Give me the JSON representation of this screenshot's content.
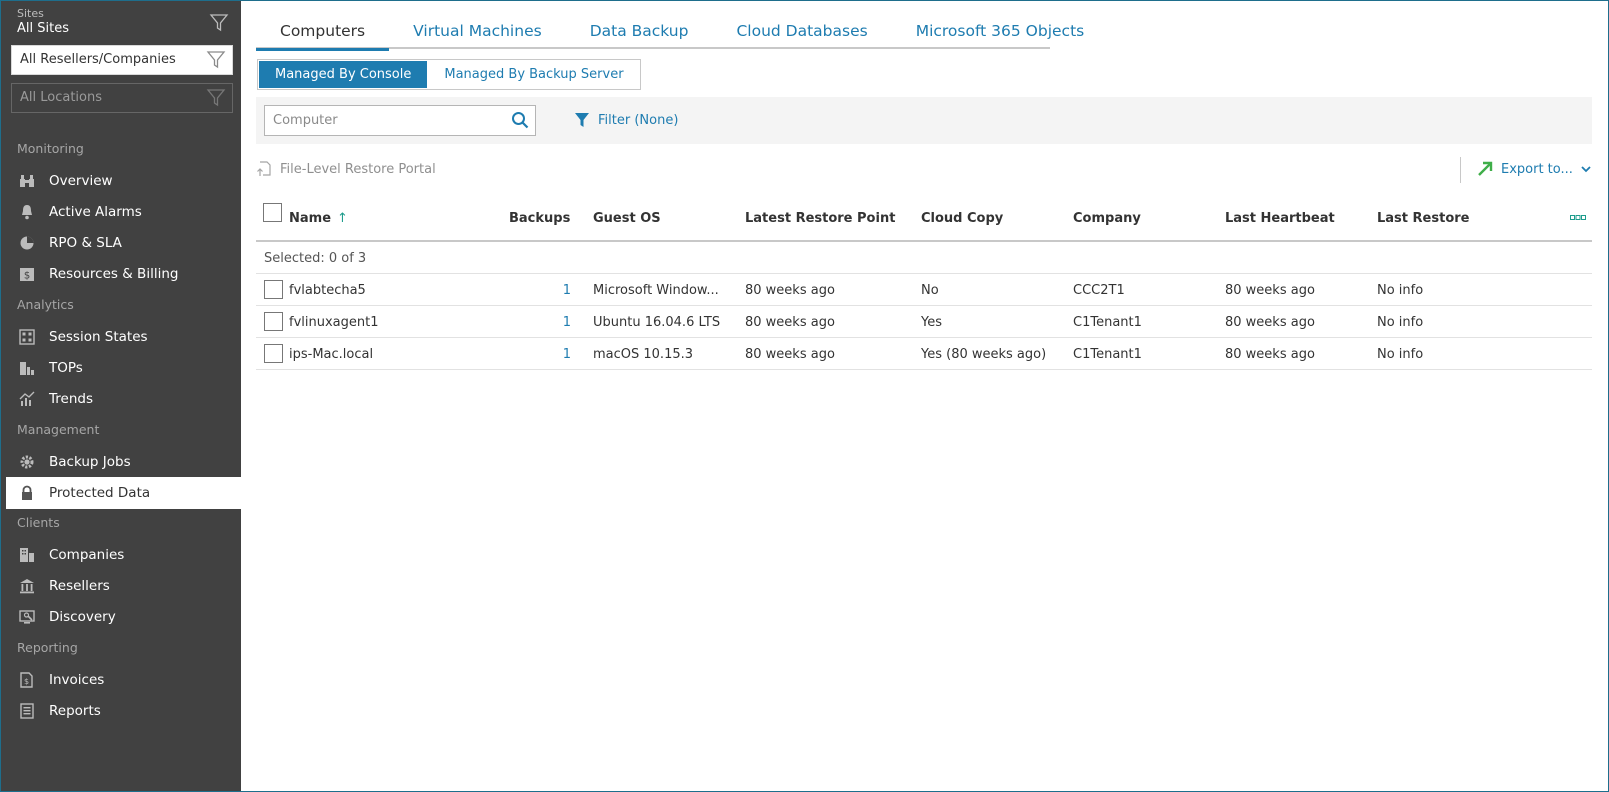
{
  "sidebar": {
    "site_label": "Sites",
    "site_value": "All Sites",
    "reseller_filter": "All Resellers/Companies",
    "location_filter": "All Locations",
    "sections": {
      "monitoring": "Monitoring",
      "analytics": "Analytics",
      "management": "Management",
      "clients": "Clients",
      "reporting": "Reporting"
    },
    "items": {
      "overview": "Overview",
      "active_alarms": "Active Alarms",
      "rpo_sla": "RPO & SLA",
      "resources_billing": "Resources & Billing",
      "session_states": "Session States",
      "tops": "TOPs",
      "trends": "Trends",
      "backup_jobs": "Backup Jobs",
      "protected_data": "Protected Data",
      "companies": "Companies",
      "resellers": "Resellers",
      "discovery": "Discovery",
      "invoices": "Invoices",
      "reports": "Reports"
    }
  },
  "tabs": {
    "computers": "Computers",
    "virtual_machines": "Virtual Machines",
    "data_backup": "Data Backup",
    "cloud_databases": "Cloud Databases",
    "m365": "Microsoft 365 Objects"
  },
  "toggle": {
    "console": "Managed By Console",
    "backup_server": "Managed By Backup Server"
  },
  "search": {
    "placeholder": "Computer"
  },
  "filter": {
    "label": "Filter (None)"
  },
  "toolbar": {
    "portal": "File-Level Restore Portal",
    "export": "Export to..."
  },
  "grid": {
    "columns": {
      "name": "Name",
      "backups": "Backups",
      "guest_os": "Guest OS",
      "latest_restore_point": "Latest Restore Point",
      "cloud_copy": "Cloud Copy",
      "company": "Company",
      "last_heartbeat": "Last Heartbeat",
      "last_restore": "Last Restore"
    },
    "sort_indicator": "↑",
    "selected_text": "Selected: 0 of 3",
    "rows": [
      {
        "name": "fvlabtecha5",
        "backups": "1",
        "guest_os": "Microsoft Window...",
        "latest_restore_point": "80 weeks ago",
        "cloud_copy": "No",
        "company": "CCC2T1",
        "last_heartbeat": "80 weeks ago",
        "last_restore": "No info"
      },
      {
        "name": "fvlinuxagent1",
        "backups": "1",
        "guest_os": "Ubuntu 16.04.6 LTS",
        "latest_restore_point": "80 weeks ago",
        "cloud_copy": "Yes",
        "company": "C1Tenant1",
        "last_heartbeat": "80 weeks ago",
        "last_restore": "No info"
      },
      {
        "name": "ips-Mac.local",
        "backups": "1",
        "guest_os": "macOS 10.15.3",
        "latest_restore_point": "80 weeks ago",
        "cloud_copy": "Yes (80 weeks ago)",
        "company": "C1Tenant1",
        "last_heartbeat": "80 weeks ago",
        "last_restore": "No info"
      }
    ]
  },
  "colors": {
    "accent": "#1e7cb0",
    "sidebar_bg": "#414141",
    "export_arrow": "#3fae49",
    "sort_arrow": "#1e9c8c"
  }
}
